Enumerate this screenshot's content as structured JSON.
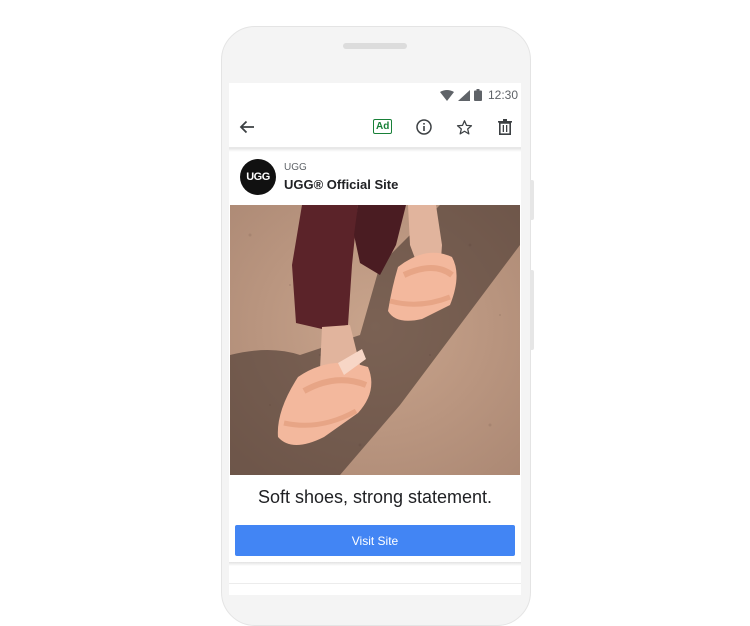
{
  "status_bar": {
    "time": "12:30"
  },
  "toolbar": {
    "ad_label": "Ad"
  },
  "advertiser": {
    "logo_text": "UGG",
    "name": "UGG",
    "title": "UGG® Official Site"
  },
  "ad": {
    "headline": "Soft shoes, strong statement.",
    "cta_label": "Visit Site"
  },
  "colors": {
    "cta": "#4285f4",
    "ad_badge": "#188038",
    "logo_bg": "#111111"
  },
  "icons": [
    "wifi-icon",
    "signal-icon",
    "battery-icon",
    "back-arrow-icon",
    "info-icon",
    "star-icon",
    "trash-icon"
  ]
}
